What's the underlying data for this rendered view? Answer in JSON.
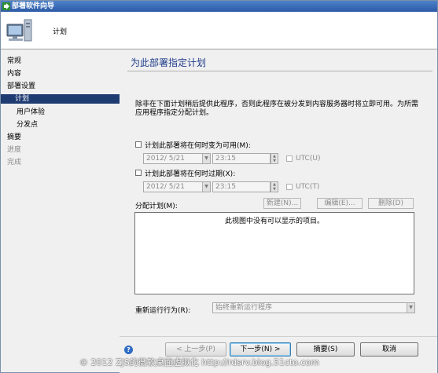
{
  "window": {
    "title": "部署软件向导"
  },
  "header": {
    "title": "计划"
  },
  "sidebar": {
    "items": [
      {
        "label": "常规"
      },
      {
        "label": "内容"
      },
      {
        "label": "部署设置"
      },
      {
        "label": "计划"
      },
      {
        "label": "用户体验"
      },
      {
        "label": "分发点"
      },
      {
        "label": "摘要"
      },
      {
        "label": "进度"
      },
      {
        "label": "完成"
      }
    ],
    "selected": "计划"
  },
  "main": {
    "title": "为此部署指定计划",
    "description": "除非在下面计划稍后提供此程序，否则此程序在被分发到内容服务器时将立即可用。为所需应用程序指定分配计划。",
    "available": {
      "checkbox_label": "计划此部署将在何时变为可用(M):",
      "checked": false,
      "date": "2012/ 5/21",
      "time": "23:15",
      "utc_label": "UTC(U)"
    },
    "expire": {
      "checkbox_label": "计划此部署将在何时过期(X):",
      "checked": false,
      "date": "2012/ 5/21",
      "time": "23:15",
      "utc_label": "UTC(T)"
    },
    "assignment": {
      "label": "分配计划(M):",
      "new_label": "新建(N)...",
      "edit_label": "编辑(E)...",
      "delete_label": "删除(D)",
      "empty_text": "此视图中没有可以显示的项目。"
    },
    "rerun": {
      "label": "重新运行行为(R):",
      "value": "始终重新运行程序"
    }
  },
  "footer": {
    "prev_label": "< 上一步(P)",
    "next_label": "下一步(N) >",
    "summary_label": "摘要(S)",
    "cancel_label": "取消"
  },
  "watermark": "© 2012 ZJS的微软桌面虚拟化 http://rdsrv.blog.51cto.com"
}
